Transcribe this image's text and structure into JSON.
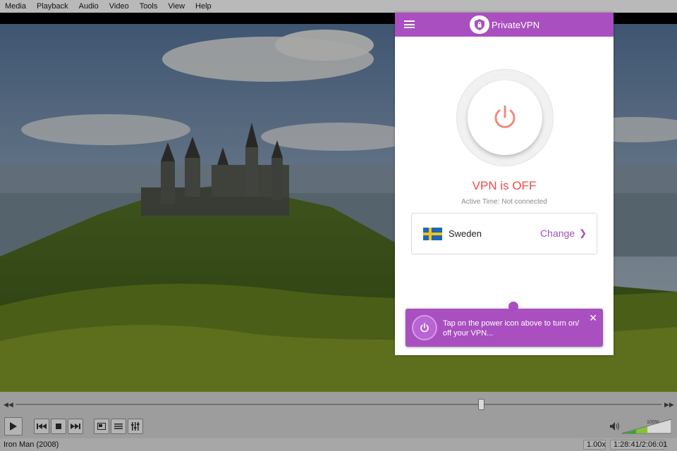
{
  "menubar": {
    "items": [
      "Media",
      "Playback",
      "Audio",
      "Video",
      "Tools",
      "View",
      "Help"
    ]
  },
  "vpn": {
    "brand": "PrivateVPN",
    "status": "VPN is OFF",
    "active_time": "Active Time: Not connected",
    "server": {
      "country": "Sweden",
      "change_label": "Change",
      "flag": "sweden-flag"
    },
    "tooltip": {
      "text": "Tap on the power icon above to turn on/ off your VPN...",
      "close": "✕"
    },
    "colors": {
      "accent": "#a94fc0",
      "status_off": "#ef4a46"
    }
  },
  "player": {
    "title": "Iron Man (2008)",
    "speed": "1.00x",
    "time": "1:28:41/2:06:01",
    "volume_label": "100%",
    "volume_level": 1.0,
    "seek_position": 0.72
  }
}
